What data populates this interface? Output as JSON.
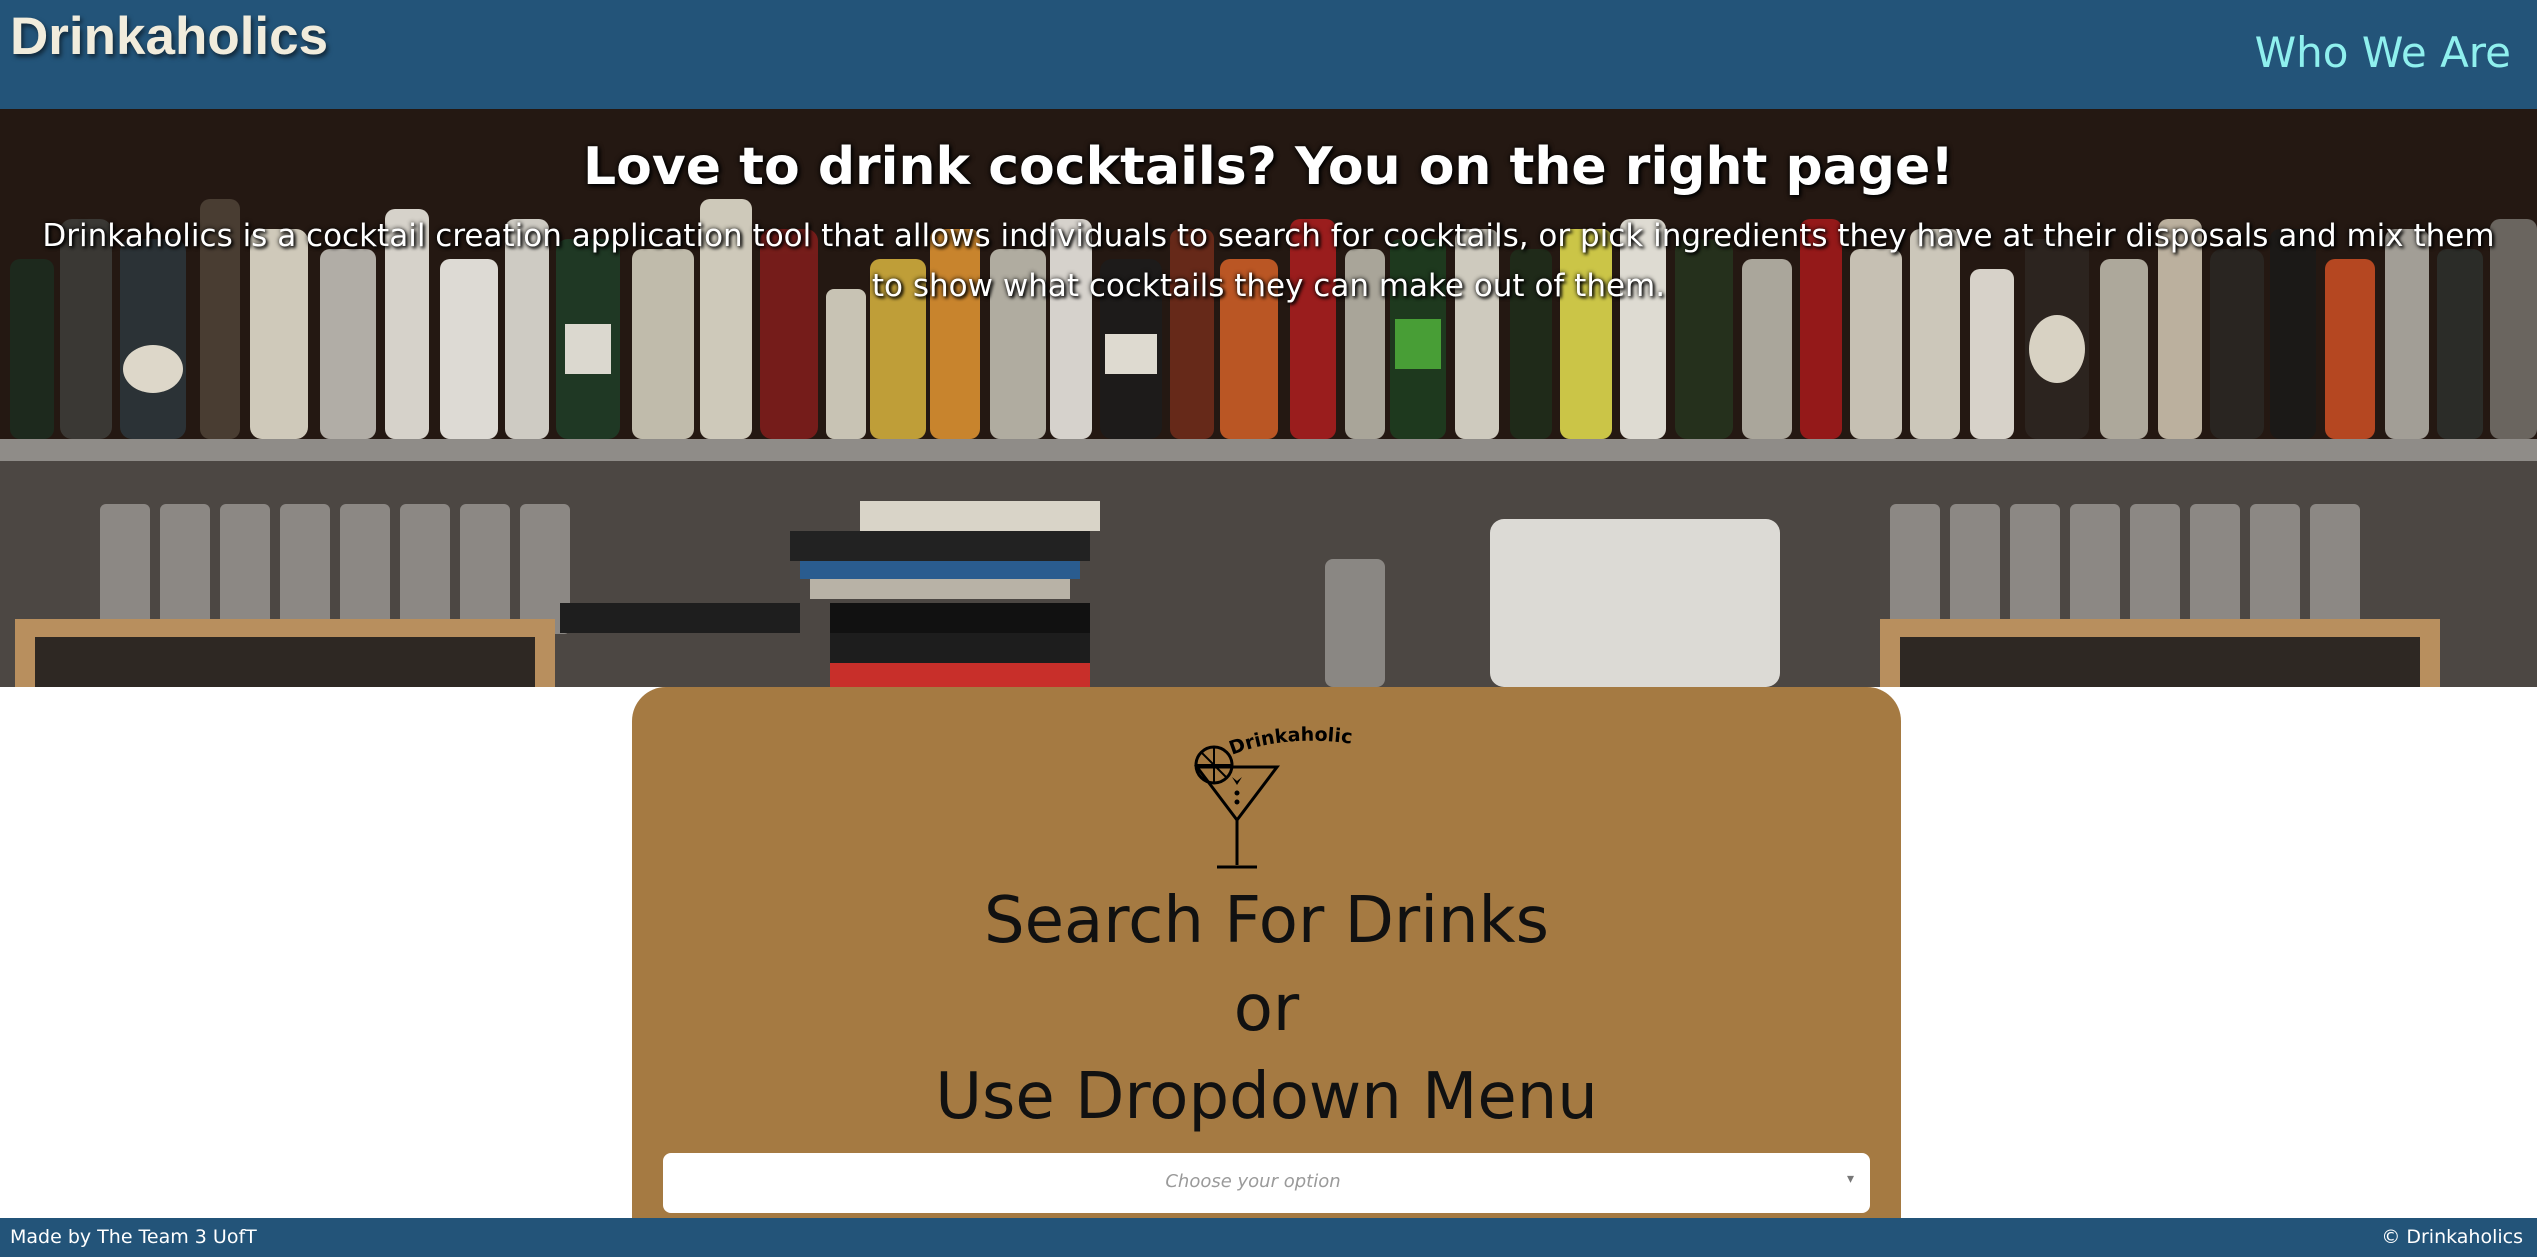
{
  "header": {
    "brand": "Drinkaholics",
    "nav_link": "Who We Are"
  },
  "hero": {
    "title": "Love to drink cocktails? You on the right page!",
    "description": "Drinkaholics is a cocktail creation application tool that allows individuals to search for cocktails, or pick ingredients they have at their disposals and mix them to show what cocktails they can make out of them."
  },
  "search_card": {
    "logo_text": "Drinkaholics",
    "heading_line1": "Search For Drinks",
    "heading_line2": "or",
    "heading_line3": "Use Dropdown Menu",
    "dropdown_placeholder": "Choose your option"
  },
  "footer": {
    "left": "Made by The Team 3 UofT",
    "right": "© Drinkaholics"
  },
  "colors": {
    "navbar": "#235479",
    "brand": "#f1ecdc",
    "nav_link": "#8ff0ee",
    "card": "#a57a42"
  },
  "icons": {
    "logo": "martini-glass-icon",
    "dropdown": "caret-down-icon"
  }
}
